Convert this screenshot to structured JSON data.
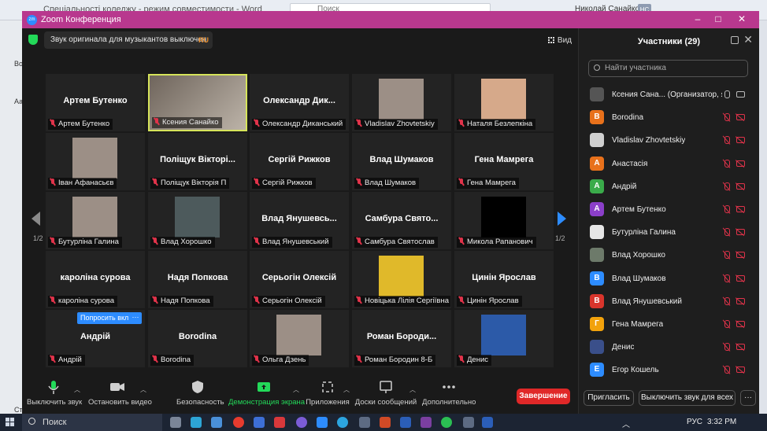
{
  "background_window": {
    "title": "Спеціальності коледжу  -  режим совместимости  -  Word",
    "search": "Поиск",
    "user": "Николай Санайко",
    "user_initials": "НС",
    "side_letters": [
      "Во",
      "Аа",
      "Ст"
    ]
  },
  "zoom": {
    "window_title": "Zoom Конференция",
    "logo": "zm",
    "original_sound_notice": "Звук оригинала для музыкантов выключен",
    "language": "RU",
    "view_label": "Вид",
    "page_left": "1/2",
    "page_right": "1/2",
    "tiles": [
      {
        "name": "Артем Бутенко",
        "label": "Артем Бутенко",
        "photo": null
      },
      {
        "name": "",
        "label": "Ксения Санайко",
        "photo": "woman-glasses-photo",
        "active": true
      },
      {
        "name": "Олександр  Дик...",
        "label": "Олександр Диканський",
        "photo": null
      },
      {
        "name": "",
        "label": "Vladislav Zhovtetskiy",
        "photo": "man-portrait-photo"
      },
      {
        "name": "",
        "label": "Наталя Безлепкіна",
        "photo": "woman-portrait-photo"
      },
      {
        "name": "",
        "label": "Іван Афанасьєв",
        "photo": "man-portrait-photo"
      },
      {
        "name": "Поліщук Вікторі...",
        "label": "Поліщук Вікторія П",
        "photo": null
      },
      {
        "name": "Сергій Рижков",
        "label": "Сергій Рижков",
        "photo": null
      },
      {
        "name": "Влад Шумаков",
        "label": "Влад Шумаков",
        "photo": null
      },
      {
        "name": "Гена Мамрега",
        "label": "Гена Мамрега",
        "photo": null
      },
      {
        "name": "",
        "label": "Бутурліна Галина",
        "photo": "man-portrait-photo"
      },
      {
        "name": "",
        "label": "Влад Хорошко",
        "photo": "room-photo"
      },
      {
        "name": "Влад  Янушевсь...",
        "label": "Влад Янушевський",
        "photo": null
      },
      {
        "name": "Самбура  Свято...",
        "label": "Самбура Святослав",
        "photo": null
      },
      {
        "name": "",
        "label": "Микола Рапанович",
        "photo": "black-video"
      },
      {
        "name": "кароліна сурова",
        "label": "кароліна сурова",
        "photo": null
      },
      {
        "name": "Надя Попкова",
        "label": "Надя Попкова",
        "photo": null
      },
      {
        "name": "Серьогін Олексій",
        "label": "Серьогін Олексій",
        "photo": null
      },
      {
        "name": "",
        "label": "Новіцька Лілія Сергіївна",
        "photo": "woman-yellow-photo"
      },
      {
        "name": "Цинін Ярослав",
        "label": "Цинін Ярослав",
        "photo": null
      },
      {
        "name": "Андрій",
        "label": "Андрій",
        "photo": null
      },
      {
        "name": "Borodina",
        "label": "Borodina",
        "photo": null
      },
      {
        "name": "",
        "label": "Ольга Дзень",
        "photo": "man-portrait-photo"
      },
      {
        "name": "Роман  Бороди...",
        "label": "Роман Бородин 8-Б",
        "photo": null
      },
      {
        "name": "",
        "label": "Денис",
        "photo": "anime-photo"
      }
    ],
    "ask_button": "Попросить вкл",
    "more_button": "···",
    "toolbar": {
      "mute": "Выключить звук",
      "video": "Остановить видео",
      "security": "Безопасность",
      "share": "Демонстрация экрана",
      "apps": "Приложения",
      "whiteboards": "Доски сообщений",
      "more": "Дополнительно",
      "end": "Завершение"
    },
    "participants_panel": {
      "title": "Участники (29)",
      "search_placeholder": "Найти участника",
      "invite": "Пригласить",
      "mute_all": "Выключить звук для всех",
      "more": "···",
      "list": [
        {
          "name": "Ксения Сана...  (Организатор, я)",
          "initial": "",
          "color": "#555555",
          "host": true
        },
        {
          "name": "Borodina",
          "initial": "B",
          "color": "#e8711b"
        },
        {
          "name": "Vladislav Zhovtetskiy",
          "initial": "",
          "color": "#cfcfcf"
        },
        {
          "name": "Анастасія",
          "initial": "А",
          "color": "#e8711b"
        },
        {
          "name": "Андрій",
          "initial": "А",
          "color": "#3aab4a"
        },
        {
          "name": "Артем Бутенко",
          "initial": "А",
          "color": "#8b3fc9"
        },
        {
          "name": "Бутурліна Галина",
          "initial": "",
          "color": "#e6e6e6"
        },
        {
          "name": "Влад Хорошко",
          "initial": "",
          "color": "#6d7a6a"
        },
        {
          "name": "Влад Шумаков",
          "initial": "В",
          "color": "#2d8cff"
        },
        {
          "name": "Влад Янушевський",
          "initial": "В",
          "color": "#d9352c"
        },
        {
          "name": "Гена Мамрега",
          "initial": "Г",
          "color": "#f2a20c"
        },
        {
          "name": "Денис",
          "initial": "",
          "color": "#3a4f8a"
        },
        {
          "name": "Егор Кошель",
          "initial": "Е",
          "color": "#2d8cff"
        }
      ]
    }
  },
  "taskbar": {
    "search": "Поиск",
    "language": "РУС",
    "time": "3:32 PM"
  }
}
